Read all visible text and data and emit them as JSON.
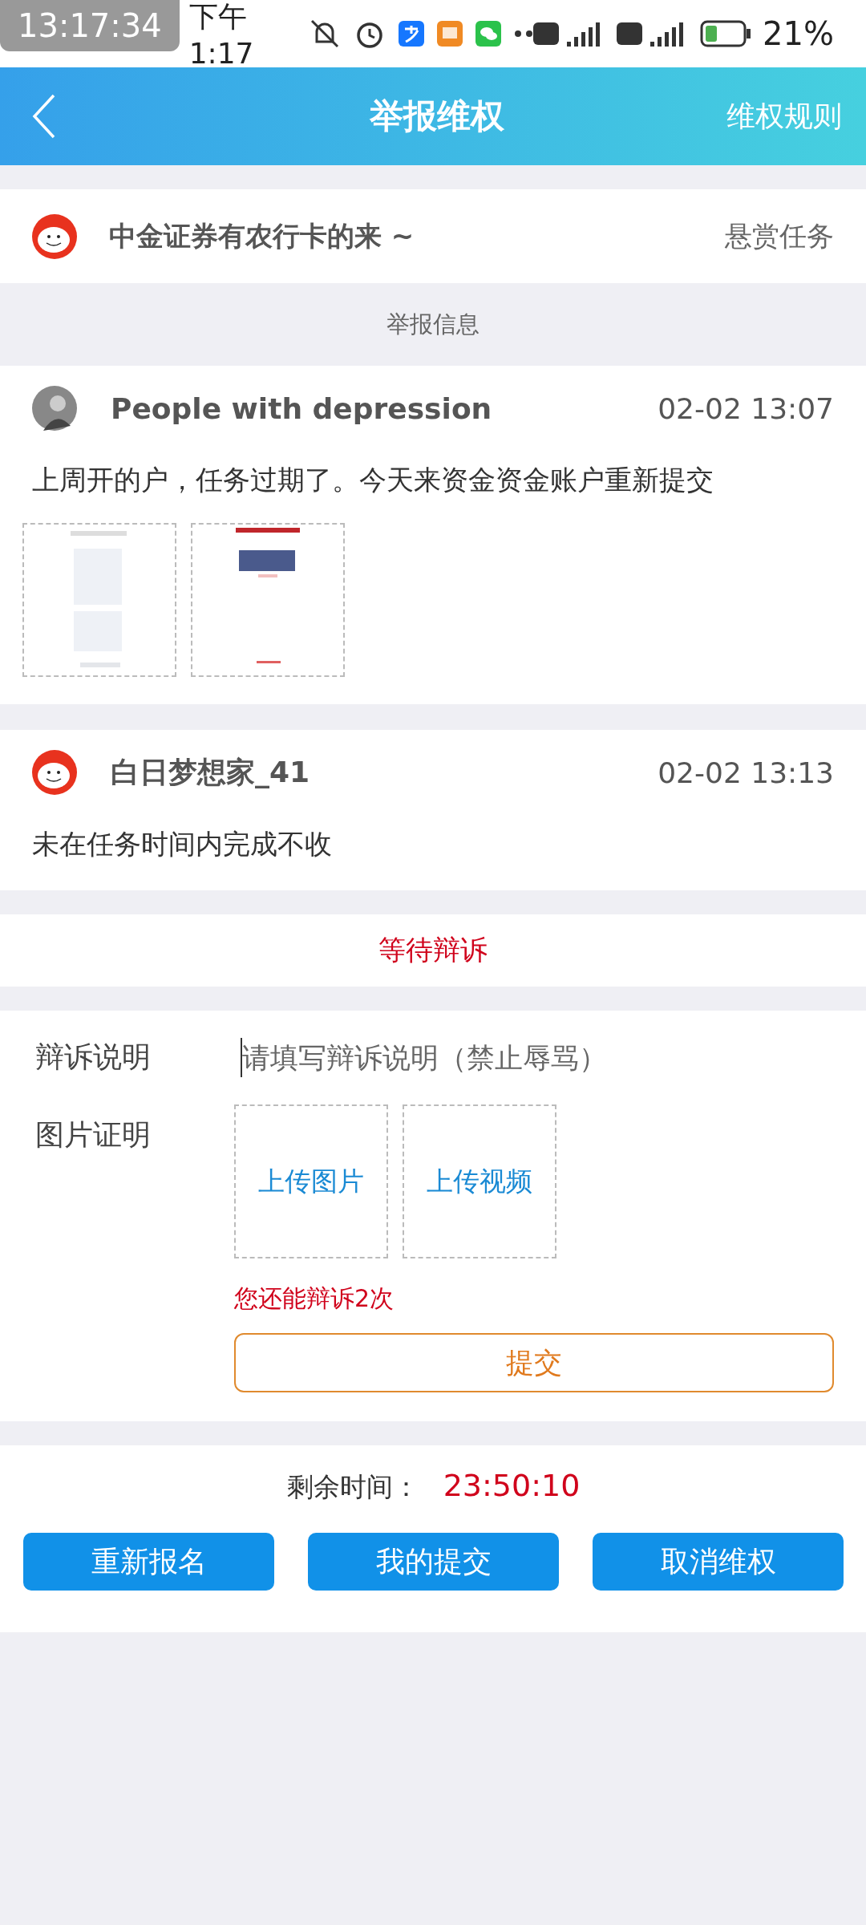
{
  "status_bar": {
    "overlay_time": "13:17:34",
    "time": "下午1:17",
    "battery": "21%"
  },
  "header": {
    "title": "举报维权",
    "action": "维权规则"
  },
  "task": {
    "title": "中金证券有农行卡的来 ~",
    "tag": "悬赏任务"
  },
  "section_title": "举报信息",
  "posts": [
    {
      "author": "People with depression",
      "time": "02-02 13:07",
      "text": "上周开的户，任务过期了。今天来资金资金账户重新提交"
    },
    {
      "author": "白日梦想家_41",
      "time": "02-02 13:13",
      "text": "未在任务时间内完成不收"
    }
  ],
  "status": "等待辩诉",
  "form": {
    "reason_label": "辩诉说明",
    "reason_placeholder": "请填写辩诉说明（禁止辱骂）",
    "proof_label": "图片证明",
    "uploads": [
      "上传图片",
      "上传视频"
    ],
    "remaining_note": "您还能辩诉2次",
    "submit": "提交"
  },
  "footer": {
    "countdown_label": "剩余时间：",
    "countdown": "23:50:10",
    "buttons": [
      "重新报名",
      "我的提交",
      "取消维权"
    ]
  }
}
